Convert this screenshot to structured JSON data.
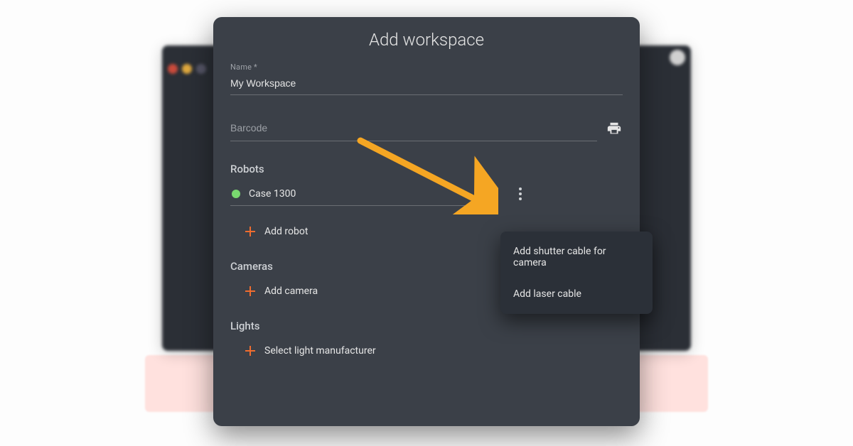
{
  "modal": {
    "title": "Add workspace",
    "fields": {
      "name": {
        "label": "Name *",
        "value": "My Workspace"
      },
      "barcode": {
        "placeholder": "Barcode"
      }
    },
    "sections": {
      "robots": {
        "title": "Robots",
        "items": [
          {
            "name": "Case 1300",
            "status": "online"
          }
        ],
        "add_label": "Add robot"
      },
      "cameras": {
        "title": "Cameras",
        "add_label": "Add camera"
      },
      "lights": {
        "title": "Lights",
        "add_label": "Select light manufacturer"
      }
    }
  },
  "popup": {
    "items": [
      "Add shutter cable for camera",
      "Add laser cable"
    ]
  },
  "colors": {
    "accent": "#ef6c2f",
    "status_online": "#79d86f",
    "modal_bg": "#3b4048",
    "popup_bg": "#2b3038"
  }
}
